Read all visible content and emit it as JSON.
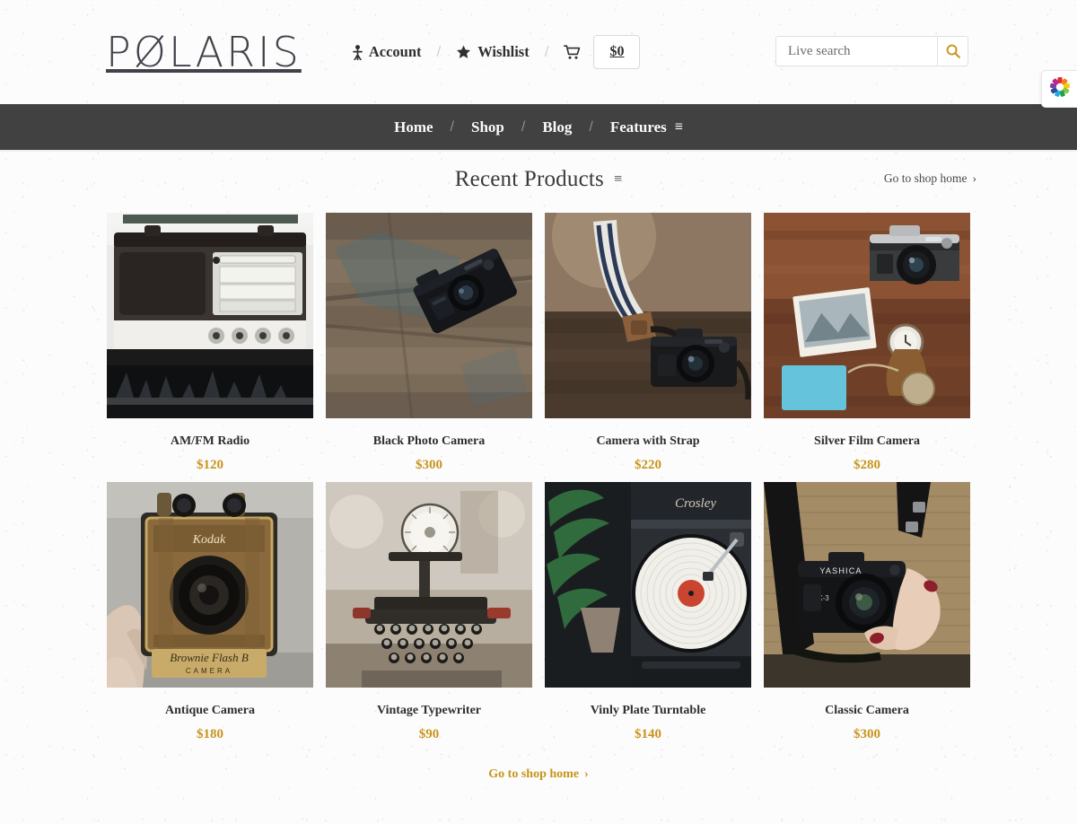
{
  "brand": {
    "logo_text": "PØLARIS"
  },
  "header": {
    "account_label": "Account",
    "wishlist_label": "Wishlist",
    "separator": "/",
    "cart_total": "$0",
    "account_icon": "person-icon",
    "wishlist_icon": "star-icon",
    "cart_icon": "shopping-cart-icon"
  },
  "search": {
    "placeholder": "Live search",
    "value": "",
    "icon": "search-icon",
    "icon_color": "#c8941a"
  },
  "nav": {
    "separator": "/",
    "items": [
      {
        "label": "Home"
      },
      {
        "label": "Shop"
      },
      {
        "label": "Blog"
      },
      {
        "label": "Features"
      }
    ],
    "features_icon": "hamburger-bars-icon",
    "features_glyph": "≡",
    "background_color": "#414141"
  },
  "section": {
    "title": "Recent Products",
    "title_glyph": "≡",
    "shop_home_top_label": "Go to shop home",
    "shop_home_top_chevron": "›",
    "shop_home_bottom_label": "Go to shop home",
    "shop_home_bottom_chevron": "›",
    "price_color": "#c8941a"
  },
  "products": [
    {
      "name": "AM/FM Radio",
      "price": "$120",
      "image": "vintage-am-fm-radio"
    },
    {
      "name": "Black Photo Camera",
      "price": "$300",
      "image": "black-camera-on-wood"
    },
    {
      "name": "Camera with Strap",
      "price": "$220",
      "image": "camera-with-striped-strap"
    },
    {
      "name": "Silver Film Camera",
      "price": "$280",
      "image": "silver-canon-film-camera"
    },
    {
      "name": "Antique Camera",
      "price": "$180",
      "image": "kodak-brownie-flash-b"
    },
    {
      "name": "Vintage Typewriter",
      "price": "$90",
      "image": "vintage-typewriter"
    },
    {
      "name": "Vinly Plate Turntable",
      "price": "$140",
      "image": "crosley-record-turntable"
    },
    {
      "name": "Classic Camera",
      "price": "$300",
      "image": "yashica-camera-in-hands"
    }
  ],
  "color_switcher": {
    "icon": "color-wheel-icon",
    "label": "Color switcher"
  }
}
